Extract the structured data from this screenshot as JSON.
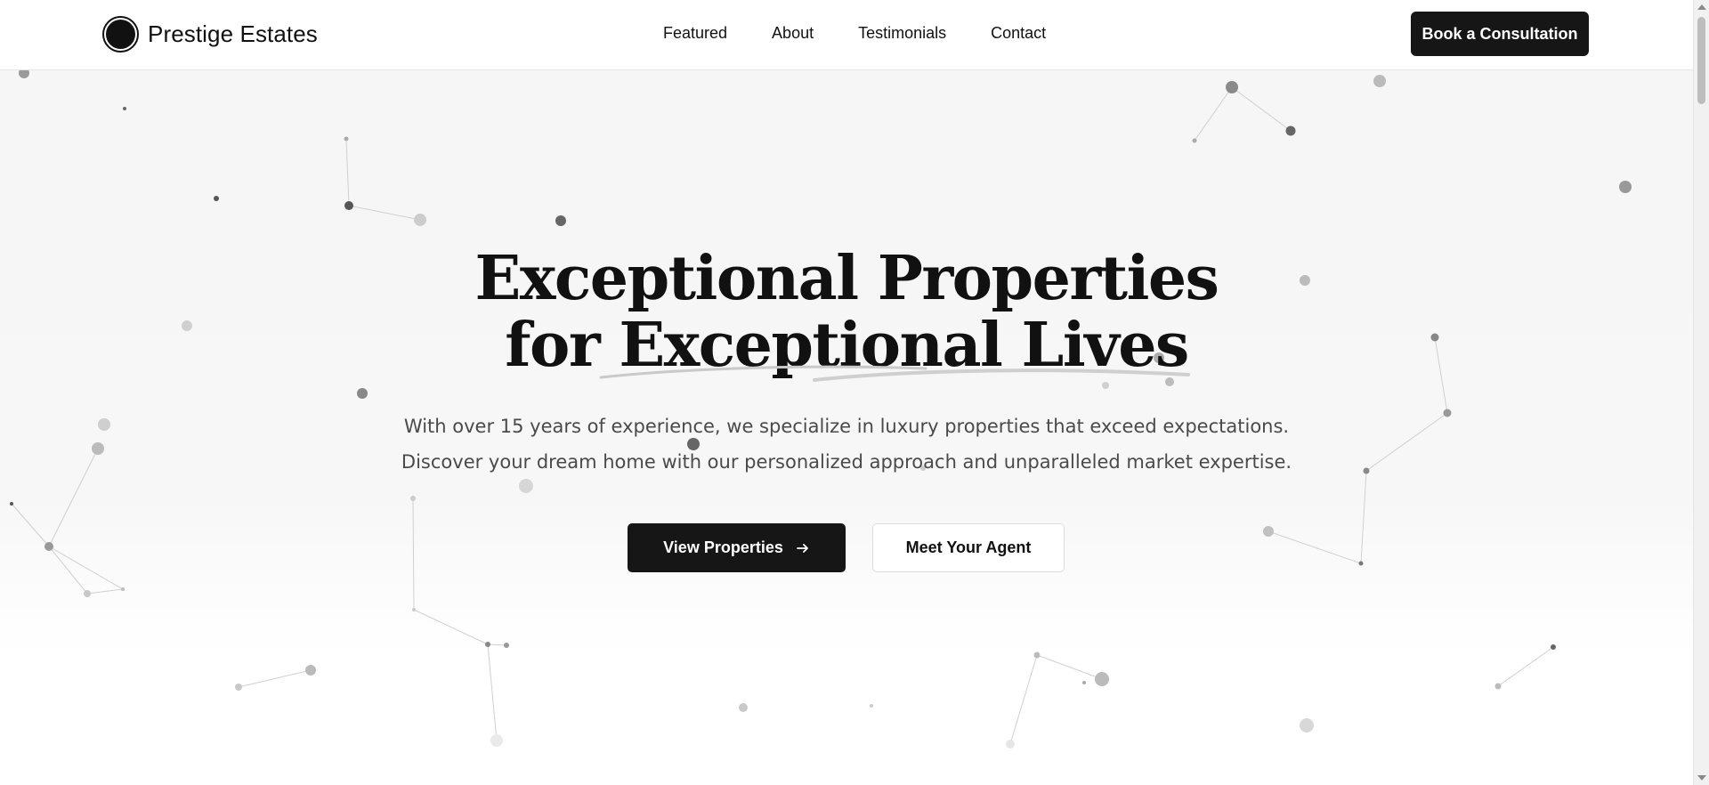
{
  "brand": {
    "name": "Prestige Estates",
    "logo_icon": "circle-logo-icon"
  },
  "nav": {
    "items": [
      {
        "label": "Featured"
      },
      {
        "label": "About"
      },
      {
        "label": "Testimonials"
      },
      {
        "label": "Contact"
      }
    ],
    "cta_label": "Book a Consultation"
  },
  "hero": {
    "title_line1": "Exceptional Properties",
    "title_line2": "for Exceptional Lives",
    "subtitle_line1": "With over 15 years of experience, we specialize in luxury properties that exceed expectations.",
    "subtitle_line2": "Discover your dream home with our personalized approach and unparalleled market expertise.",
    "primary_button_label": "View Properties",
    "primary_button_icon": "arrow-right-icon",
    "secondary_button_label": "Meet Your Agent"
  },
  "colors": {
    "text": "#111111",
    "button_dark": "#161616",
    "subtitle": "#4a4a4a",
    "background": "#f6f6f6"
  }
}
